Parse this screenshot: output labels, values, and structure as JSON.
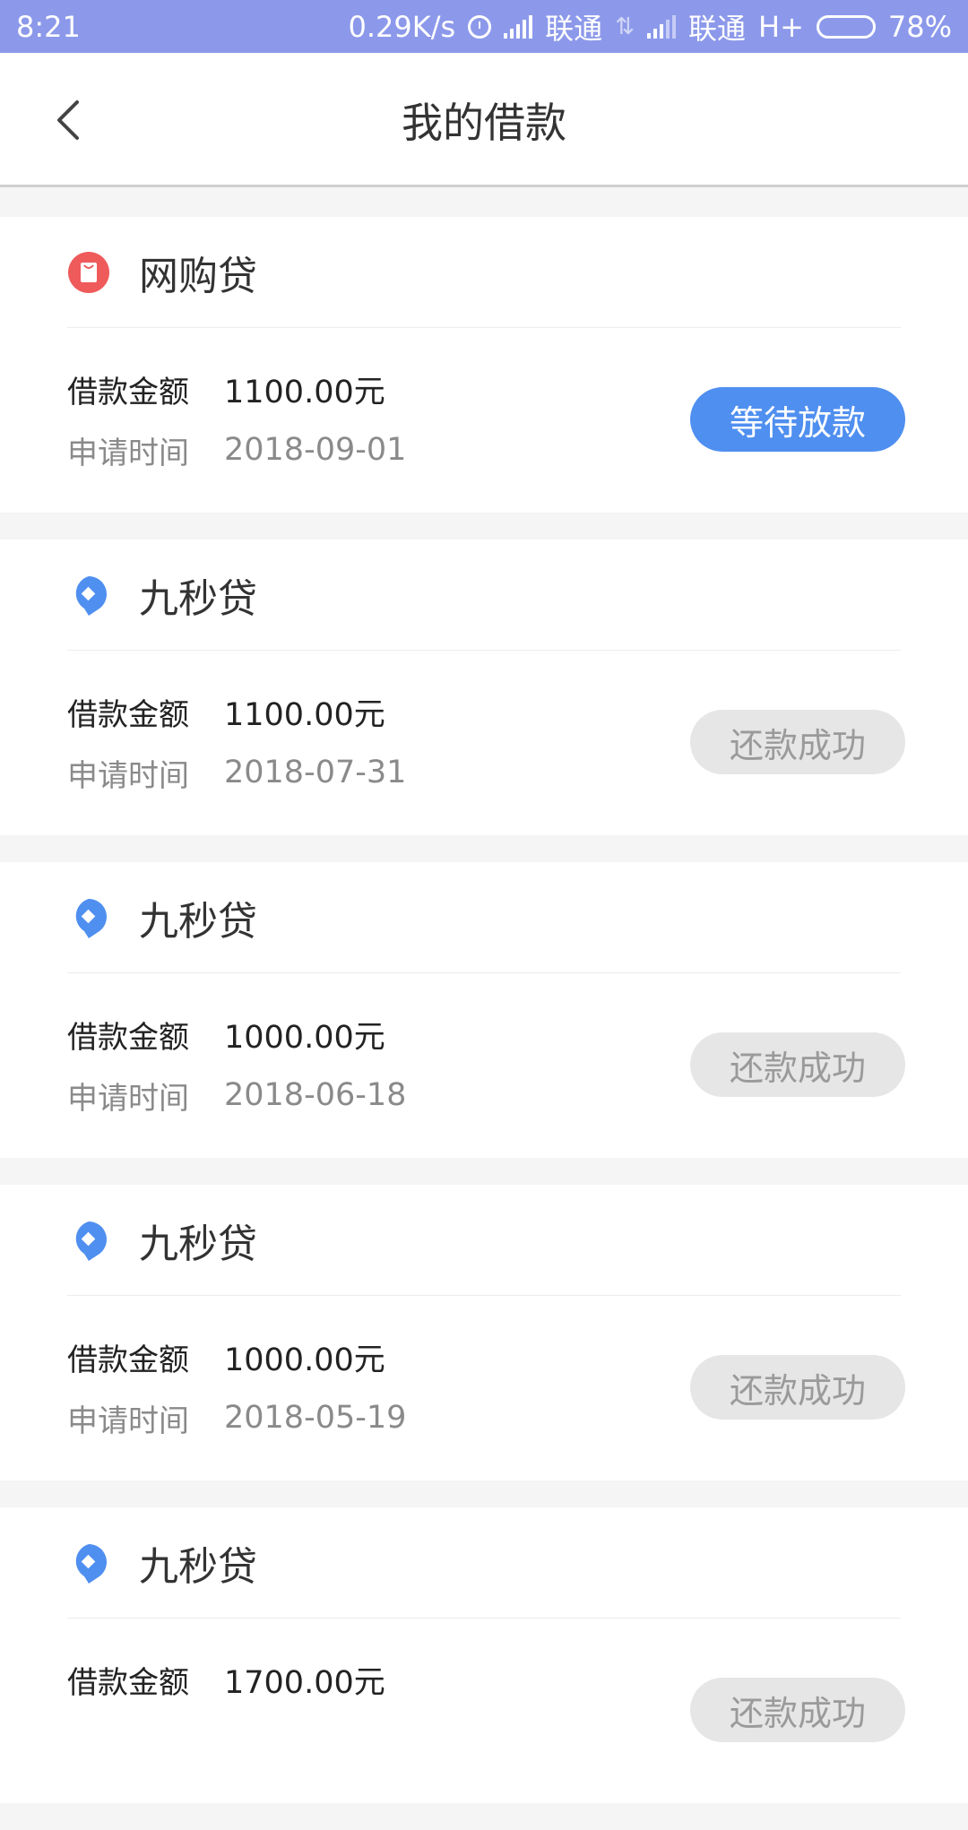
{
  "status_bar": {
    "time": "8:21",
    "speed": "0.29K/s",
    "carrier1": "联通",
    "carrier2": "联通",
    "network": "H+",
    "battery": "78%",
    "battery_level": 0.78
  },
  "header": {
    "title": "我的借款",
    "back_icon": "chevron-left-icon"
  },
  "colors": {
    "status_bar": "#8c99ea",
    "accent": "#4f8ff0",
    "wanggou_icon": "#ef5a5a",
    "jiumiao_icon": "#4f8ff0",
    "done_bg": "#e6e6e6"
  },
  "loans": [
    {
      "product": "网购贷",
      "icon": "shopping-bag-icon",
      "amount_label": "借款金额",
      "amount": "1100.00元",
      "date_label": "申请时间",
      "date": "2018-09-01",
      "status": "等待放款",
      "status_type": "pending"
    },
    {
      "product": "九秒贷",
      "icon": "location-pin-icon",
      "amount_label": "借款金额",
      "amount": "1100.00元",
      "date_label": "申请时间",
      "date": "2018-07-31",
      "status": "还款成功",
      "status_type": "done"
    },
    {
      "product": "九秒贷",
      "icon": "location-pin-icon",
      "amount_label": "借款金额",
      "amount": "1000.00元",
      "date_label": "申请时间",
      "date": "2018-06-18",
      "status": "还款成功",
      "status_type": "done"
    },
    {
      "product": "九秒贷",
      "icon": "location-pin-icon",
      "amount_label": "借款金额",
      "amount": "1000.00元",
      "date_label": "申请时间",
      "date": "2018-05-19",
      "status": "还款成功",
      "status_type": "done"
    },
    {
      "product": "九秒贷",
      "icon": "location-pin-icon",
      "amount_label": "借款金额",
      "amount": "1700.00元",
      "status": "还款成功",
      "status_type": "done"
    }
  ]
}
